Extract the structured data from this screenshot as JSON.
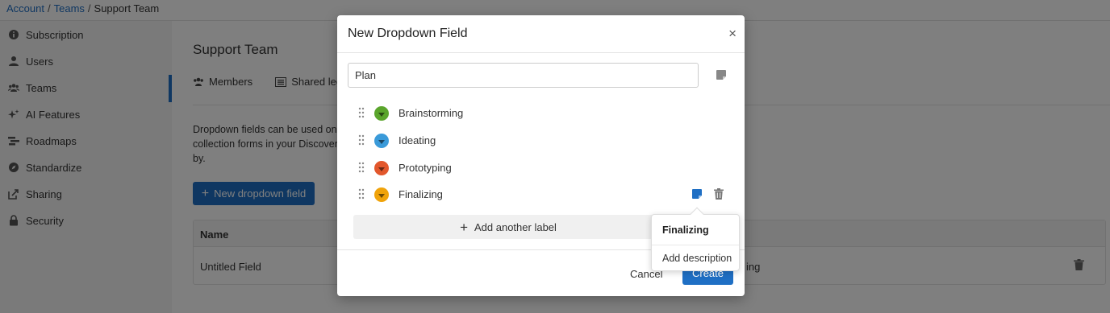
{
  "breadcrumb": {
    "account": "Account",
    "teams": "Teams",
    "current": "Support Team"
  },
  "sidebar": {
    "items": [
      {
        "label": "Subscription",
        "icon": "info-circle-icon"
      },
      {
        "label": "Users",
        "icon": "user-icon"
      },
      {
        "label": "Teams",
        "icon": "users-icon",
        "active": true
      },
      {
        "label": "AI Features",
        "icon": "sparkle-icon"
      },
      {
        "label": "Roadmaps",
        "icon": "roadmap-icon"
      },
      {
        "label": "Standardize",
        "icon": "compass-icon"
      },
      {
        "label": "Sharing",
        "icon": "share-icon"
      },
      {
        "label": "Security",
        "icon": "lock-icon"
      }
    ]
  },
  "main": {
    "title": "Support Team",
    "tabs": [
      {
        "label": "Members"
      },
      {
        "label": "Shared leg"
      }
    ],
    "description": "Dropdown fields can be used on c collection forms in your Discovery by.",
    "new_button": "New dropdown field",
    "table": {
      "header": "Name",
      "row_name": "Untitled Field",
      "row_other": "ing"
    }
  },
  "modal": {
    "title": "New Dropdown Field",
    "close": "×",
    "field_name": "Plan",
    "options": [
      {
        "label": "Brainstorming",
        "color": "#5aa52c"
      },
      {
        "label": "Ideating",
        "color": "#3a9ad9"
      },
      {
        "label": "Prototyping",
        "color": "#e2572c"
      },
      {
        "label": "Finalizing",
        "color": "#f0a30a"
      }
    ],
    "add_label": "Add another label",
    "cancel": "Cancel",
    "create": "Create"
  },
  "popover": {
    "title": "Finalizing",
    "action": "Add description"
  },
  "colors": {
    "accent": "#1f6fc4",
    "overlay": "rgba(0,0,0,0.5)"
  }
}
